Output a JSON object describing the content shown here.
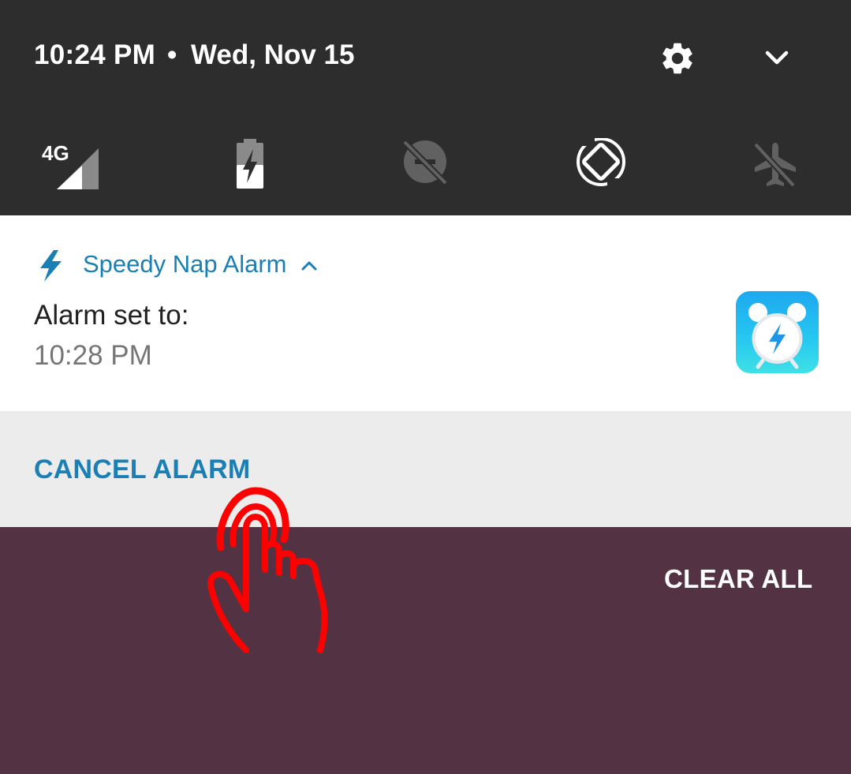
{
  "status": {
    "time": "10:24 PM",
    "separator": "•",
    "date": "Wed, Nov 15"
  },
  "quick_settings": [
    {
      "name": "mobile-data",
      "icon": "signal-4g-icon",
      "label": "4G"
    },
    {
      "name": "battery-saver",
      "icon": "battery-charging-icon"
    },
    {
      "name": "do-not-disturb",
      "icon": "dnd-off-icon"
    },
    {
      "name": "auto-rotate",
      "icon": "auto-rotate-icon"
    },
    {
      "name": "airplane-mode",
      "icon": "airplane-off-icon"
    }
  ],
  "notification": {
    "app_name": "Speedy Nap Alarm",
    "title": "Alarm set to:",
    "text": "10:28 PM",
    "action": "CANCEL ALARM"
  },
  "clear_all": "CLEAR ALL",
  "colors": {
    "shade_bg": "#2d2d2d",
    "accent": "#1a7fb5",
    "wallpaper": "#533343",
    "pointer": "#ff0000"
  }
}
